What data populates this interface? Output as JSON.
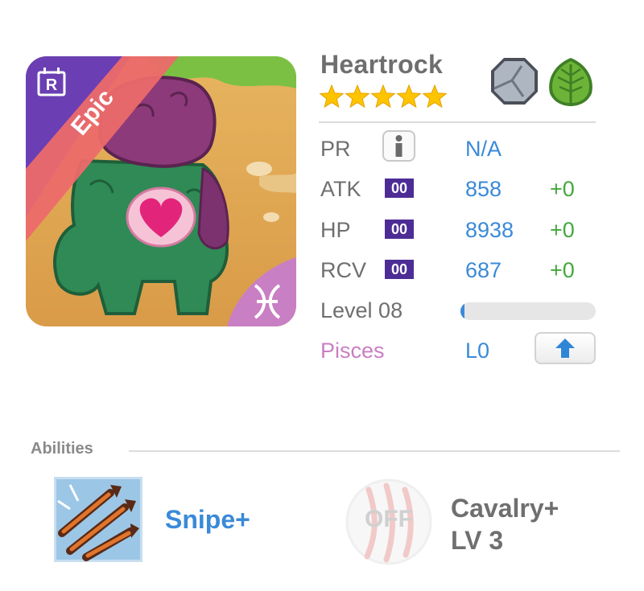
{
  "monster": {
    "name": "Heartrock",
    "stars": 5,
    "rarity_label": "Epic",
    "rarity_tag": "R",
    "element_icons": [
      "rock-element-icon",
      "leaf-element-icon"
    ],
    "zodiac_icon": "pisces-icon"
  },
  "stats": {
    "pr": {
      "label": "PR",
      "value": "N/A"
    },
    "atk": {
      "label": "ATK",
      "badge": "00",
      "value": "858",
      "bonus": "+0"
    },
    "hp": {
      "label": "HP",
      "badge": "00",
      "value": "8938",
      "bonus": "+0"
    },
    "rcv": {
      "label": "RCV",
      "badge": "00",
      "value": "687",
      "bonus": "+0"
    }
  },
  "level": {
    "label": "Level 08",
    "progress": 0.03
  },
  "sign": {
    "label": "Pisces",
    "value": "L0"
  },
  "abilities": {
    "title": "Abilities",
    "first": {
      "label": "Snipe+",
      "icon": "snipe-arrows-icon"
    },
    "second": {
      "status": "OFF",
      "label_line1": "Cavalry+",
      "label_line2": "LV 3",
      "icon": "claw-marks-icon"
    }
  },
  "colors": {
    "accent_blue": "#3a8ad8",
    "bonus_green": "#43a83c",
    "badge_purple": "#4d2d95",
    "epic_ribbon": "#ec6a6a",
    "pisces_pink": "#c97fc3",
    "star_yellow": "#ffc400"
  }
}
